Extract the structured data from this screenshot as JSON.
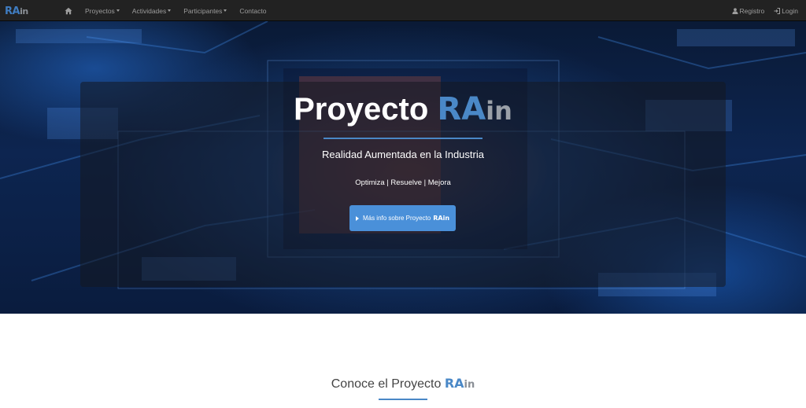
{
  "navbar": {
    "brand": {
      "ra": "RA",
      "in": "in"
    },
    "home_icon": "home-icon",
    "items": [
      {
        "label": "Proyectos",
        "dropdown": true
      },
      {
        "label": "Actividades",
        "dropdown": true
      },
      {
        "label": "Participantes",
        "dropdown": true
      },
      {
        "label": "Contacto",
        "dropdown": false
      }
    ],
    "right": [
      {
        "label": "Registro",
        "icon": "user-icon"
      },
      {
        "label": "Login",
        "icon": "login-icon"
      }
    ]
  },
  "hero": {
    "title_prefix": "Proyecto",
    "title_ra": "RA",
    "title_in": "in",
    "subtitle": "Realidad Aumentada en la Industria",
    "tagline": "Optimiza | Resuelve | Mejora",
    "button": {
      "label": "Más info sobre Proyecto",
      "logo": "RAin",
      "icon": "play-icon"
    }
  },
  "section": {
    "title_prefix": "Conoce el Proyecto",
    "title_ra": "RA",
    "title_in": "in"
  },
  "colors": {
    "navbar_bg": "#222222",
    "nav_text": "#9d9d9d",
    "accent": "#4a88c7",
    "button": "#4a90d9"
  }
}
